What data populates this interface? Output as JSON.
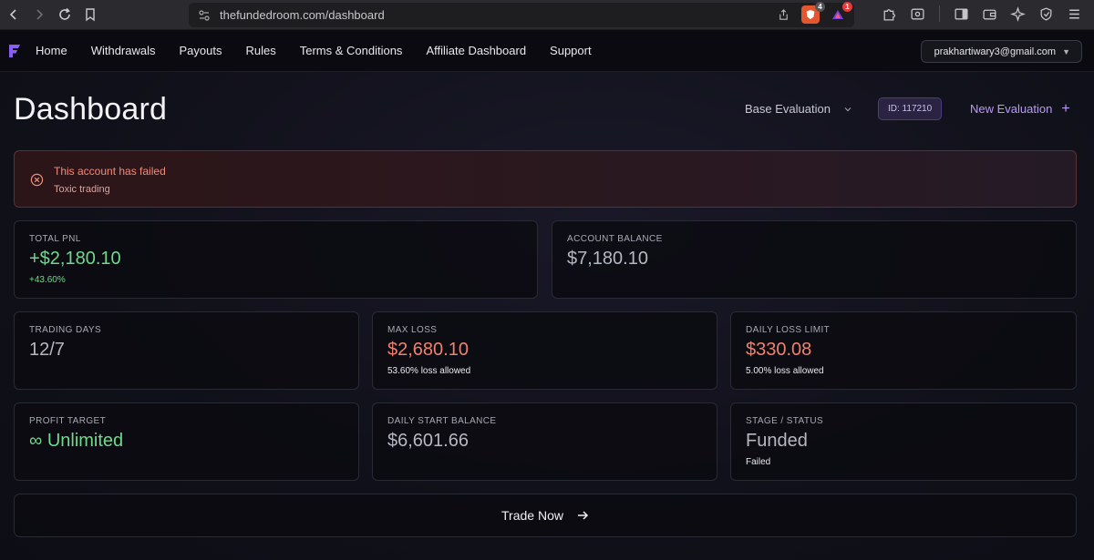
{
  "browser": {
    "url": "thefundedroom.com/dashboard",
    "brave_badge": "4",
    "ext_badge": "1"
  },
  "header": {
    "nav": [
      "Home",
      "Withdrawals",
      "Payouts",
      "Rules",
      "Terms & Conditions",
      "Affiliate Dashboard",
      "Support"
    ],
    "user_email": "prakhartiwary3@gmail.com",
    "caret": "▼"
  },
  "dashboard": {
    "title": "Dashboard",
    "evaluation_select": "Base Evaluation",
    "account_id": "ID: 117210",
    "new_evaluation": "New Evaluation",
    "new_evaluation_icon": "+"
  },
  "alert": {
    "title": "This account has failed",
    "reason": "Toxic trading"
  },
  "stats": {
    "total_pnl": {
      "label": "TOTAL PNL",
      "value": "+$2,180.10",
      "sub": "+43.60%"
    },
    "account_balance": {
      "label": "ACCOUNT BALANCE",
      "value": "$7,180.10"
    },
    "trading_days": {
      "label": "TRADING DAYS",
      "value": "12/7"
    },
    "max_loss": {
      "label": "MAX LOSS",
      "value": "$2,680.10",
      "sub": "53.60% loss allowed"
    },
    "daily_loss_limit": {
      "label": "DAILY LOSS LIMIT",
      "value": "$330.08",
      "sub": "5.00% loss allowed"
    },
    "profit_target": {
      "label": "PROFIT TARGET",
      "value": "∞ Unlimited"
    },
    "daily_start_balance": {
      "label": "DAILY START BALANCE",
      "value": "$6,601.66"
    },
    "stage_status": {
      "label": "STAGE / STATUS",
      "value": "Funded",
      "sub": "Failed"
    }
  },
  "trade_button": "Trade Now",
  "colors": {
    "positive": "#6fd98c",
    "negative": "#f0816f",
    "accent": "#b89cf3"
  }
}
